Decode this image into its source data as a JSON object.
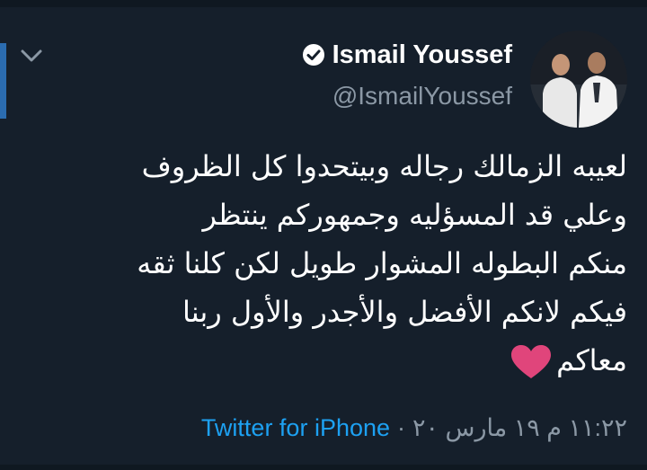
{
  "tweet": {
    "display_name": "Ismail Youssef",
    "handle": "@IsmailYoussef",
    "verified": true,
    "lines": [
      "لعيبه الزمالك رجاله وبيتحدوا كل الظروف",
      "وعلي قد المسؤليه وجمهوركم ينتظر",
      "منكم البطوله المشوار طويل لكن كلنا ثقه",
      "فيكم لانكم الأفضل  والأجدر  والأول ربنا",
      "معاكم"
    ],
    "emoji": "pink-heart",
    "time": "١١:٢٢ م",
    "date": "١٩ مارس ٢٠",
    "separator": "·",
    "source": "Twitter for iPhone"
  },
  "colors": {
    "background": "#151f2b",
    "text": "#ffffff",
    "muted": "#8b98a5",
    "link": "#1da1f2",
    "heart": "#e0457b",
    "thread_line": "#2b6cb0"
  },
  "icons": {
    "menu": "chevron-down-icon",
    "verified": "verified-badge-icon",
    "avatar": "profile-photo"
  }
}
